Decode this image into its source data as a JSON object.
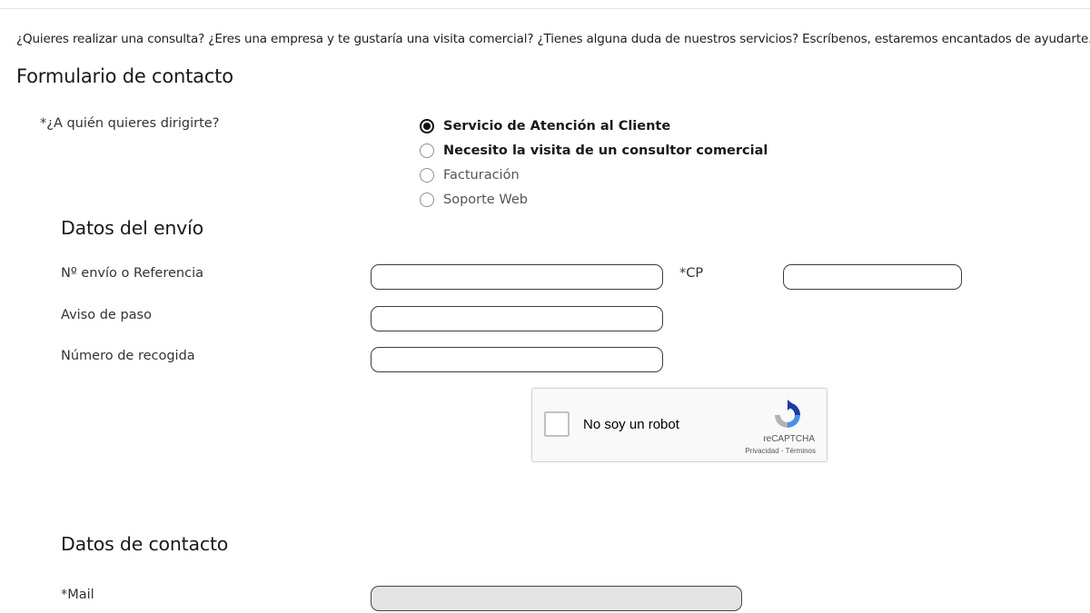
{
  "intro": "¿Quieres realizar una consulta? ¿Eres una empresa y te gustaría una visita comercial? ¿Tienes alguna duda de nuestros servicios? Escríbenos, estaremos encantados de ayudarte.",
  "form_title": "Formulario de contacto",
  "recipient": {
    "label": "*¿A quién quieres dirigirte?",
    "options": [
      {
        "label": "Servicio de Atención al Cliente",
        "checked": true
      },
      {
        "label": "Necesito la visita de un consultor comercial",
        "checked": false
      },
      {
        "label": "Facturación",
        "checked": false
      },
      {
        "label": "Soporte Web",
        "checked": false
      }
    ]
  },
  "shipping": {
    "title": "Datos del envío",
    "reference_label": "Nº envío o Referencia",
    "reference_value": "",
    "cp_label": "*CP",
    "cp_value": "",
    "notice_label": "Aviso de paso",
    "notice_value": "",
    "pickup_label": "Número de recogida",
    "pickup_value": ""
  },
  "captcha": {
    "label": "No soy un robot",
    "brand": "reCAPTCHA",
    "privacy": "Privacidad",
    "separator": " - ",
    "terms": "Términos",
    "checked": false,
    "logo_colors": {
      "blue": "#1c3aa9",
      "light_blue": "#4a90e2",
      "gray": "#b3b3b3"
    }
  },
  "contact": {
    "title": "Datos de contacto",
    "mail_label": "*Mail",
    "mail_value": ""
  }
}
